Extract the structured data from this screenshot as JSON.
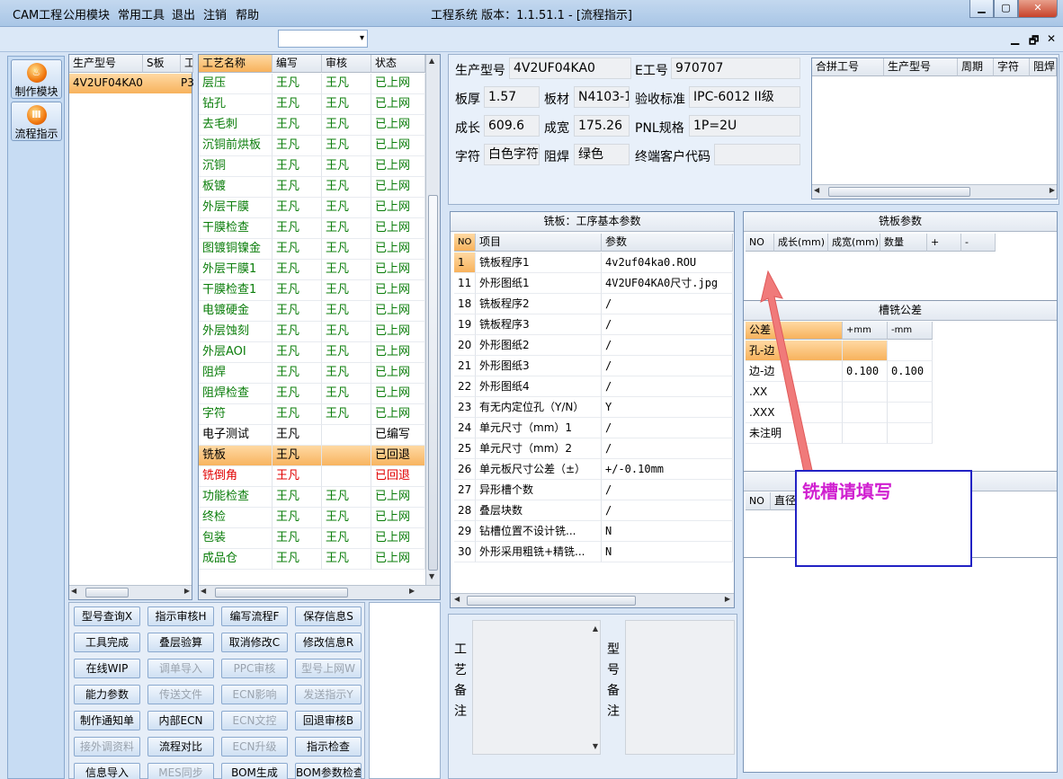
{
  "window": {
    "title": "工程系统  版本：1.1.51.1 - [流程指示]",
    "min": "▁",
    "max": "▢",
    "close": "✕"
  },
  "menu": {
    "items": [
      "CAM工程",
      "公用模块",
      "常用工具",
      "退出",
      "注销",
      "帮助"
    ],
    "combo_arrow": "▾",
    "mdi": [
      "▁",
      "🗗",
      "✕"
    ]
  },
  "sidebar": {
    "buttons": [
      {
        "label": "制作模块",
        "icon": "fire-icon"
      },
      {
        "label": "流程指示",
        "icon": "flow-icon"
      }
    ]
  },
  "model_list": {
    "headers": [
      "生产型号",
      "S板",
      "工"
    ],
    "rows": [
      [
        "4V2UF04KA0",
        "",
        "P3"
      ]
    ]
  },
  "process": {
    "headers": [
      "工艺名称",
      "编写",
      "审核",
      "状态"
    ],
    "rows": [
      {
        "name": "层压",
        "writer": "王凡",
        "reviewer": "王凡",
        "status": "已上网",
        "color": "green"
      },
      {
        "name": "钻孔",
        "writer": "王凡",
        "reviewer": "王凡",
        "status": "已上网",
        "color": "green"
      },
      {
        "name": "去毛刺",
        "writer": "王凡",
        "reviewer": "王凡",
        "status": "已上网",
        "color": "green"
      },
      {
        "name": "沉铜前烘板",
        "writer": "王凡",
        "reviewer": "王凡",
        "status": "已上网",
        "color": "green"
      },
      {
        "name": "沉铜",
        "writer": "王凡",
        "reviewer": "王凡",
        "status": "已上网",
        "color": "green"
      },
      {
        "name": "板镀",
        "writer": "王凡",
        "reviewer": "王凡",
        "status": "已上网",
        "color": "green"
      },
      {
        "name": "外层干膜",
        "writer": "王凡",
        "reviewer": "王凡",
        "status": "已上网",
        "color": "green"
      },
      {
        "name": "干膜检查",
        "writer": "王凡",
        "reviewer": "王凡",
        "status": "已上网",
        "color": "green"
      },
      {
        "name": "图镀铜镍金",
        "writer": "王凡",
        "reviewer": "王凡",
        "status": "已上网",
        "color": "green"
      },
      {
        "name": "外层干膜1",
        "writer": "王凡",
        "reviewer": "王凡",
        "status": "已上网",
        "color": "green"
      },
      {
        "name": "干膜检查1",
        "writer": "王凡",
        "reviewer": "王凡",
        "status": "已上网",
        "color": "green"
      },
      {
        "name": "电镀硬金",
        "writer": "王凡",
        "reviewer": "王凡",
        "status": "已上网",
        "color": "green"
      },
      {
        "name": "外层蚀刻",
        "writer": "王凡",
        "reviewer": "王凡",
        "status": "已上网",
        "color": "green"
      },
      {
        "name": "外层AOI",
        "writer": "王凡",
        "reviewer": "王凡",
        "status": "已上网",
        "color": "green"
      },
      {
        "name": "阻焊",
        "writer": "王凡",
        "reviewer": "王凡",
        "status": "已上网",
        "color": "green"
      },
      {
        "name": "阻焊检查",
        "writer": "王凡",
        "reviewer": "王凡",
        "status": "已上网",
        "color": "green"
      },
      {
        "name": "字符",
        "writer": "王凡",
        "reviewer": "王凡",
        "status": "已上网",
        "color": "green"
      },
      {
        "name": "电子测试",
        "writer": "王凡",
        "reviewer": "",
        "status": "已编写",
        "color": "black"
      },
      {
        "name": "铣板",
        "writer": "王凡",
        "reviewer": "",
        "status": "已回退",
        "color": "selected"
      },
      {
        "name": "铣倒角",
        "writer": "王凡",
        "reviewer": "",
        "status": "已回退",
        "color": "red"
      },
      {
        "name": "功能检查",
        "writer": "王凡",
        "reviewer": "王凡",
        "status": "已上网",
        "color": "green"
      },
      {
        "name": "终检",
        "writer": "王凡",
        "reviewer": "王凡",
        "status": "已上网",
        "color": "green"
      },
      {
        "name": "包装",
        "writer": "王凡",
        "reviewer": "王凡",
        "status": "已上网",
        "color": "green"
      },
      {
        "name": "成品仓",
        "writer": "王凡",
        "reviewer": "王凡",
        "status": "已上网",
        "color": "green"
      }
    ]
  },
  "buttons": [
    {
      "label": "型号查询X",
      "enabled": true
    },
    {
      "label": "指示审核H",
      "enabled": true
    },
    {
      "label": "编写流程F",
      "enabled": true
    },
    {
      "label": "保存信息S",
      "enabled": true
    },
    {
      "label": "工具完成",
      "enabled": true
    },
    {
      "label": "叠层验算",
      "enabled": true
    },
    {
      "label": "取消修改C",
      "enabled": true
    },
    {
      "label": "修改信息R",
      "enabled": true
    },
    {
      "label": "在线WIP",
      "enabled": true
    },
    {
      "label": "调单导入",
      "enabled": false
    },
    {
      "label": "PPC审核",
      "enabled": false
    },
    {
      "label": "型号上网W",
      "enabled": false
    },
    {
      "label": "能力参数",
      "enabled": true
    },
    {
      "label": "传送文件",
      "enabled": false
    },
    {
      "label": "ECN影响",
      "enabled": false
    },
    {
      "label": "发送指示Y",
      "enabled": false
    },
    {
      "label": "制作通知单",
      "enabled": true
    },
    {
      "label": "内部ECN",
      "enabled": true
    },
    {
      "label": "ECN文控",
      "enabled": false
    },
    {
      "label": "回退审核B",
      "enabled": true
    },
    {
      "label": "接外调资料",
      "enabled": false
    },
    {
      "label": "流程对比",
      "enabled": true
    },
    {
      "label": "ECN升级",
      "enabled": false
    },
    {
      "label": "指示检查",
      "enabled": true
    },
    {
      "label": "信息导入",
      "enabled": true
    },
    {
      "label": "MES同步",
      "enabled": false
    },
    {
      "label": "BOM生成",
      "enabled": true
    },
    {
      "label": "BOM参数检查",
      "enabled": true
    }
  ],
  "info": {
    "model_label": "生产型号",
    "model": "4V2UF04KA0",
    "eno_label": "E工号",
    "eno": "970707",
    "thick_label": "板厚",
    "thick": "1.57",
    "mat_label": "板材",
    "mat": "N4103-1",
    "std_label": "验收标准",
    "std": "IPC-6012 II级",
    "len_label": "成长",
    "len": "609.6",
    "wid_label": "成宽",
    "wid": "175.26",
    "pnl_label": "PNL规格",
    "pnl": "1P=2U",
    "char_label": "字符",
    "char": "白色字符",
    "mask_label": "阻焊",
    "mask": "绿色",
    "cust_label": "终端客户代码",
    "cust": ""
  },
  "merge": {
    "headers": [
      "合拼工号",
      "生产型号",
      "周期",
      "字符",
      "阻焊"
    ]
  },
  "mill": {
    "title": "铣板：工序基本参数",
    "headers": [
      "NO",
      "项目",
      "参数"
    ],
    "rows": [
      {
        "no": "1",
        "item": "铣板程序1",
        "param": "4v2uf04ka0.ROU"
      },
      {
        "no": "11",
        "item": "外形图纸1",
        "param": "4V2UF04KA0尺寸.jpg"
      },
      {
        "no": "18",
        "item": "铣板程序2",
        "param": "/"
      },
      {
        "no": "19",
        "item": "铣板程序3",
        "param": "/"
      },
      {
        "no": "20",
        "item": "外形图纸2",
        "param": "/"
      },
      {
        "no": "21",
        "item": "外形图纸3",
        "param": "/"
      },
      {
        "no": "22",
        "item": "外形图纸4",
        "param": "/"
      },
      {
        "no": "23",
        "item": "有无内定位孔（Y/N）",
        "param": "Y"
      },
      {
        "no": "24",
        "item": "单元尺寸（mm）1",
        "param": "/"
      },
      {
        "no": "25",
        "item": "单元尺寸（mm）2",
        "param": "/"
      },
      {
        "no": "26",
        "item": "单元板尺寸公差（±）",
        "param": "+/-0.10mm"
      },
      {
        "no": "27",
        "item": "异形槽个数",
        "param": "/"
      },
      {
        "no": "28",
        "item": "叠层块数",
        "param": "/"
      },
      {
        "no": "29",
        "item": "钻槽位置不设计铣...",
        "param": "N"
      },
      {
        "no": "30",
        "item": "外形采用粗铣+精铣...",
        "param": "N"
      }
    ]
  },
  "mill_params": {
    "title": "铣板参数",
    "headers": [
      "NO",
      "成长(mm)",
      "成宽(mm)",
      "数量",
      "+",
      "-"
    ]
  },
  "slot_tol": {
    "title": "槽铣公差",
    "headers": [
      "公差",
      "+mm",
      "-mm"
    ],
    "rows": [
      [
        "孔-边",
        "",
        ""
      ],
      [
        "边-边",
        "0.100",
        "0.100"
      ],
      [
        ".XX",
        "",
        ""
      ],
      [
        ".XXX",
        "",
        ""
      ],
      [
        "未注明",
        "",
        ""
      ]
    ]
  },
  "bottom_table": {
    "headers": [
      "NO",
      "直径"
    ]
  },
  "annotation": {
    "text": "铣槽请填写"
  },
  "remarks": {
    "process_label": "工艺备注",
    "model_label": "型号备注"
  },
  "accent": {
    "selected": "#f7b25c",
    "green": "#0a7d0a",
    "red": "#e00000",
    "arrow": "#f07070",
    "box": "#2020c0",
    "annotation_text": "#d020d0"
  }
}
